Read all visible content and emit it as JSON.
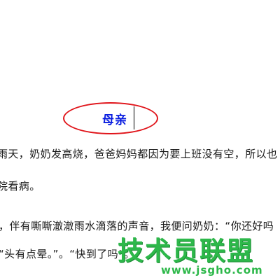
{
  "document": {
    "title": "母亲",
    "lines": [
      "雨天，奶奶发高烧，爸爸妈妈都因为要上班没有空，所以也",
      "院看病。",
      "，伴有嘶嘶澈澈雨水滴落的声音，我便问奶奶：“你还好吗",
      "“头有点晕。”。“快到了吗”。"
    ]
  },
  "watermark": {
    "text": "技术员联盟",
    "url": "www.jsgho.com"
  },
  "colors": {
    "title": "#0a1ee0",
    "ellipse": "#e0141a",
    "watermark": "#2db84a"
  }
}
